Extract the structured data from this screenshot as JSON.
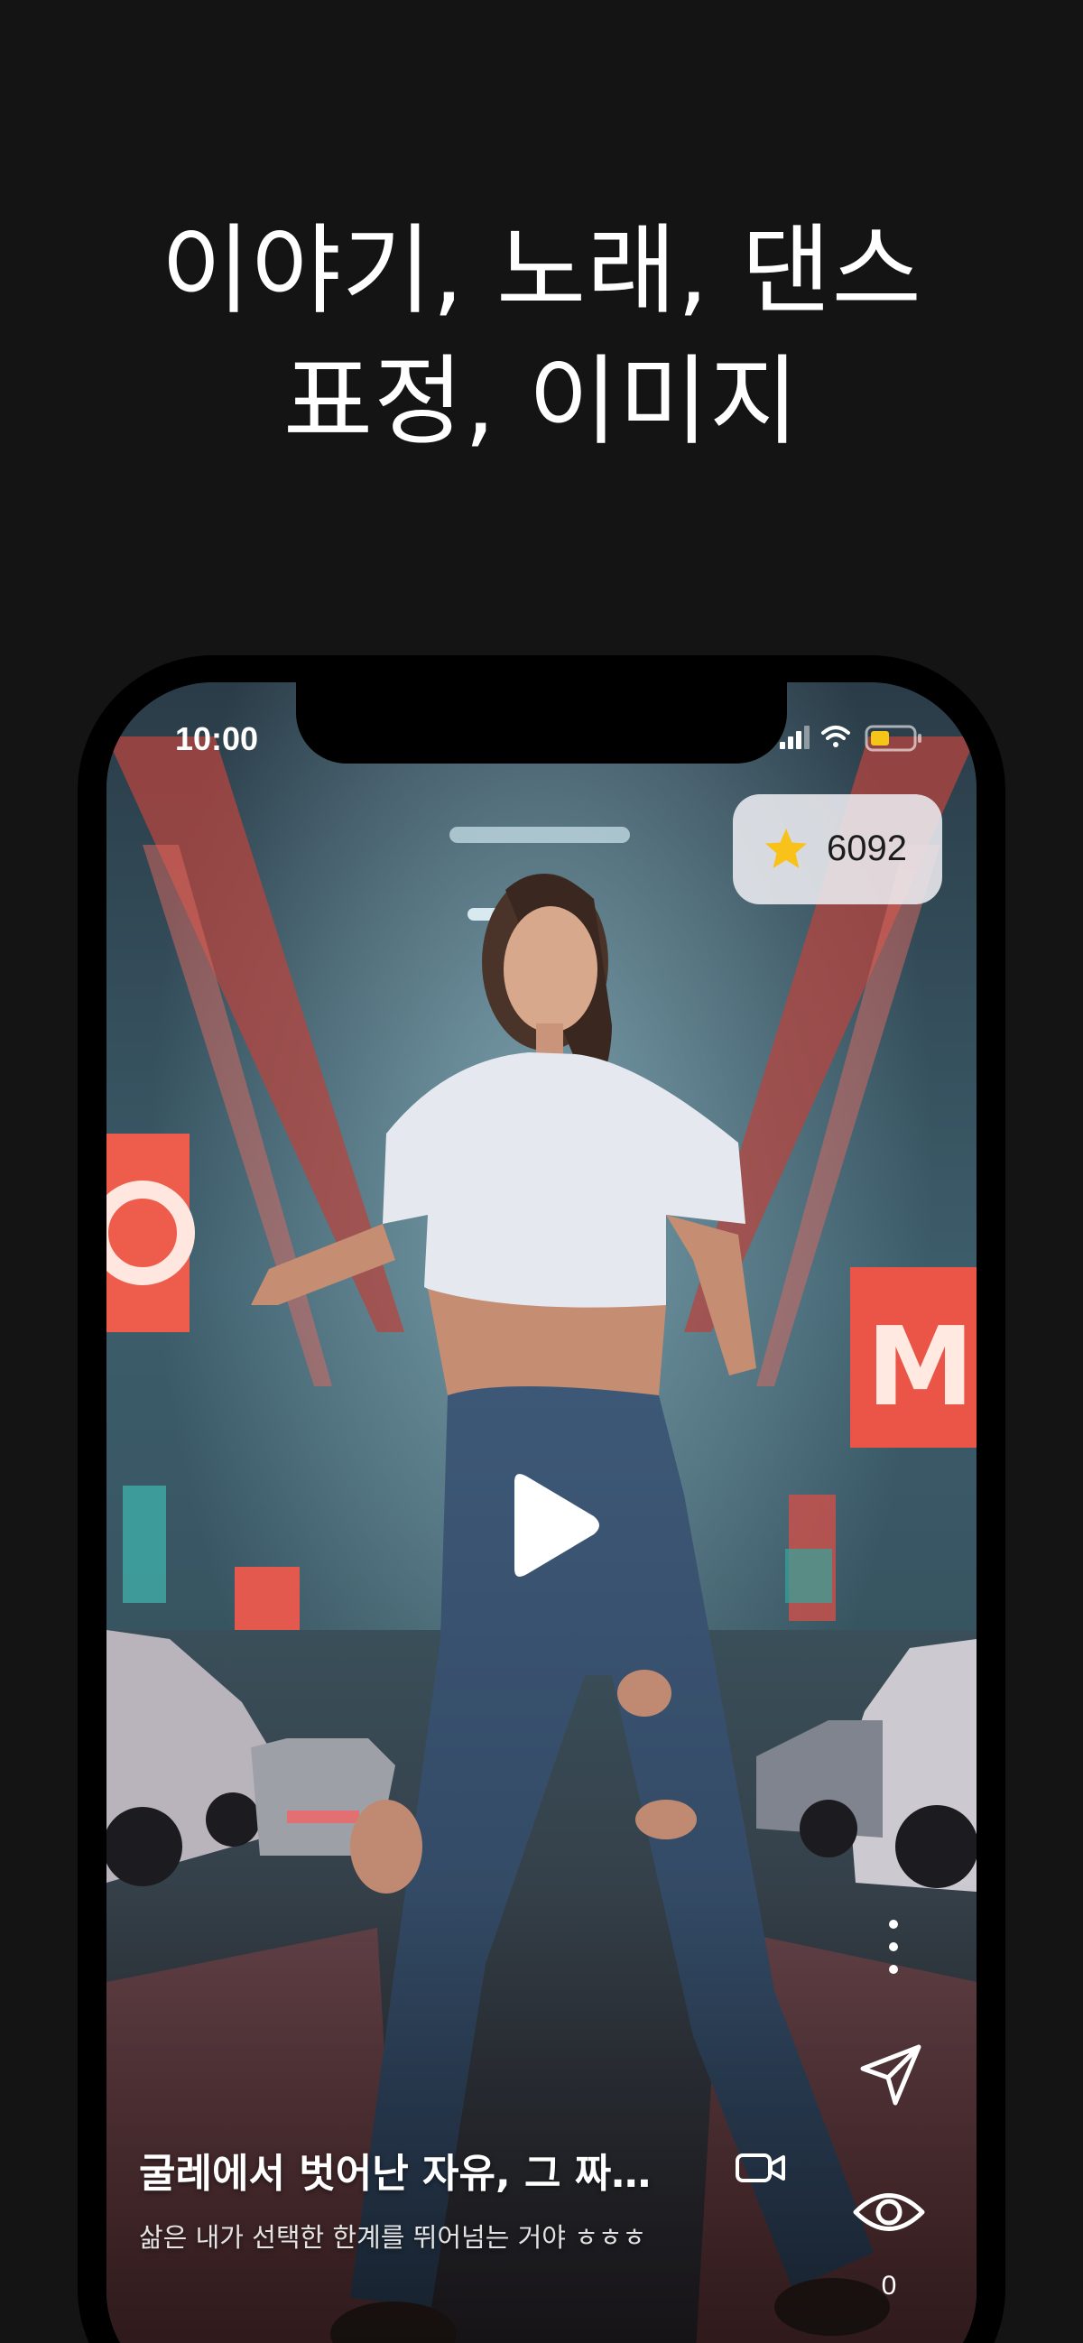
{
  "headline": {
    "line1": "이야기, 노래, 댄스",
    "line2": "표정, 이미지"
  },
  "status_bar": {
    "time": "10:00",
    "icons": [
      "cellular-signal-icon",
      "wifi-icon",
      "battery-icon"
    ],
    "battery_color": "#f5c518"
  },
  "star_badge": {
    "icon": "star-icon",
    "icon_color": "#f8c21a",
    "count": "6092"
  },
  "video": {
    "title": "굴레에서 벗어난 자유, 그 짜릿함",
    "description": "삶은 내가 선택한 한계를 뛰어넘는 거야 ㅎㅎㅎ",
    "view_count": "0"
  },
  "actions": {
    "play": "play-icon",
    "more": "more-vertical-icon",
    "share": "send-icon",
    "video_badge": "video-camera-icon",
    "views": "eye-icon"
  },
  "colors": {
    "page_background": "#141414",
    "phone_frame": "#000000",
    "text": "#ffffff"
  }
}
